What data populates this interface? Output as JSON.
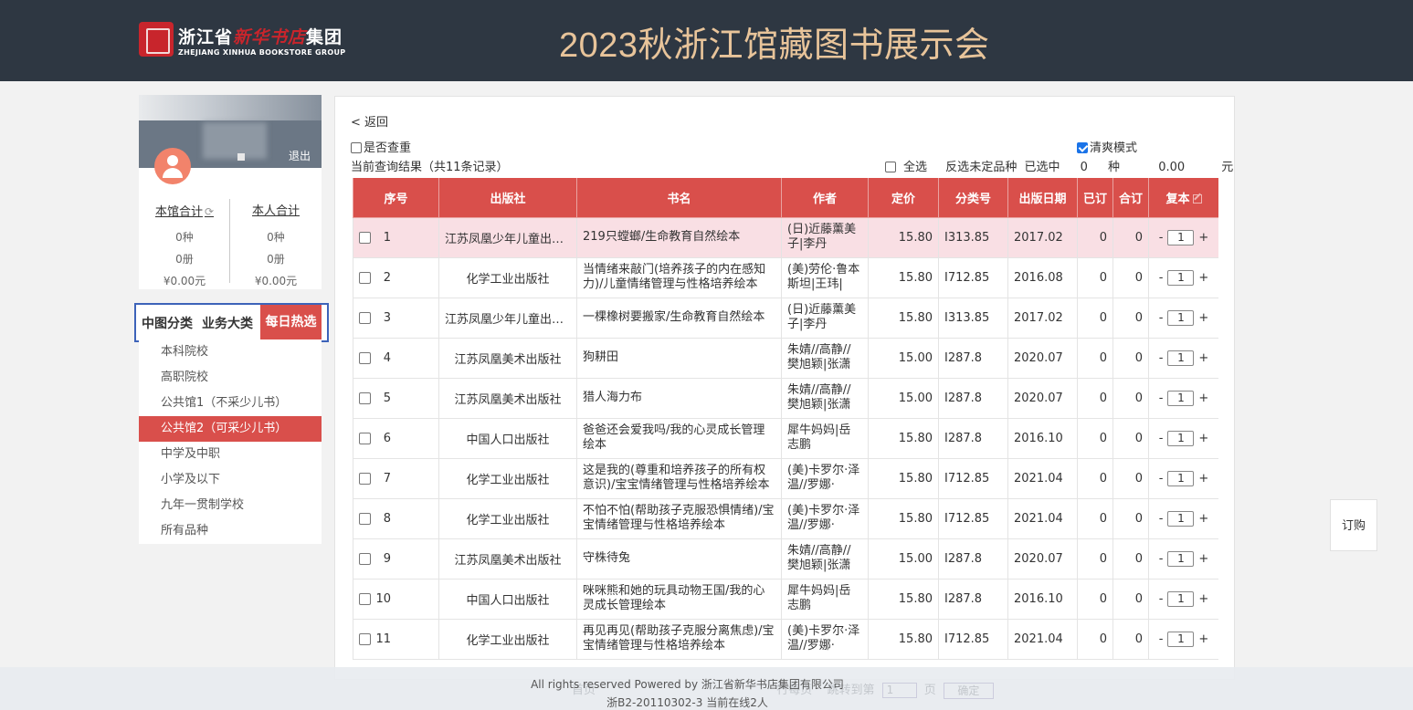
{
  "header": {
    "logo_cn_a": "浙江省",
    "logo_cn_calli": "新华书店",
    "logo_cn_b": "集团",
    "logo_en": "ZHEJIANG XINHUA BOOKSTORE GROUP",
    "title": "2023秋浙江馆藏图书展示会"
  },
  "user": {
    "logout": "退出",
    "stats": {
      "library_label": "本馆合计",
      "library_kinds": "0种",
      "library_volumes": "0册",
      "library_amount": "¥0.00元",
      "personal_label": "本人合计",
      "personal_kinds": "0种",
      "personal_volumes": "0册",
      "personal_amount": "¥0.00元"
    }
  },
  "category_tabs": [
    "中图分类",
    "业务大类",
    "每日热选"
  ],
  "category_list": [
    {
      "label": "本科院校",
      "active": false
    },
    {
      "label": "高职院校",
      "active": false
    },
    {
      "label": "公共馆1（不采少儿书）",
      "active": false
    },
    {
      "label": "公共馆2（可采少儿书）",
      "active": true
    },
    {
      "label": "中学及中职",
      "active": false
    },
    {
      "label": "小学及以下",
      "active": false
    },
    {
      "label": "九年一贯制学校",
      "active": false
    },
    {
      "label": "所有品种",
      "active": false
    }
  ],
  "main": {
    "back": "< 返回",
    "dedupe_label": "是否查重",
    "clean_mode_label": "清爽模式",
    "result_text": "当前查询结果（共11条记录）",
    "select_all": "全选",
    "invert": "反选",
    "undecided": "未定品种",
    "selected_label": "已选中",
    "selected_count": "0",
    "kind_unit": "种",
    "selected_amount": "0.00",
    "yuan_unit": "元"
  },
  "table": {
    "headers": [
      "序号",
      "出版社",
      "书名",
      "作者",
      "定价",
      "分类号",
      "出版日期",
      "已订",
      "合订",
      "复本"
    ],
    "rows": [
      {
        "no": "1",
        "publisher": "江苏凤凰少年儿童出版社",
        "title": "219只螳螂/生命教育自然绘本",
        "author": "(日)近藤薰美子|李丹",
        "price": "15.80",
        "class": "I313.85",
        "date": "2017.02",
        "ordered": "0",
        "combined": "0",
        "qty": "1"
      },
      {
        "no": "2",
        "publisher": "化学工业出版社",
        "title": "当情绪来敲门(培养孩子的内在感知力)/儿童情绪管理与性格培养绘本",
        "author": "(美)劳伦·鲁本斯坦|王玮|",
        "price": "15.80",
        "class": "I712.85",
        "date": "2016.08",
        "ordered": "0",
        "combined": "0",
        "qty": "1"
      },
      {
        "no": "3",
        "publisher": "江苏凤凰少年儿童出版社",
        "title": "一棵橡树要搬家/生命教育自然绘本",
        "author": "(日)近藤薰美子|李丹",
        "price": "15.80",
        "class": "I313.85",
        "date": "2017.02",
        "ordered": "0",
        "combined": "0",
        "qty": "1"
      },
      {
        "no": "4",
        "publisher": "江苏凤凰美术出版社",
        "title": "狗耕田",
        "author": "朱婧//高静//樊旭颖|张潇",
        "price": "15.00",
        "class": "I287.8",
        "date": "2020.07",
        "ordered": "0",
        "combined": "0",
        "qty": "1"
      },
      {
        "no": "5",
        "publisher": "江苏凤凰美术出版社",
        "title": "猎人海力布",
        "author": "朱婧//高静//樊旭颖|张潇",
        "price": "15.00",
        "class": "I287.8",
        "date": "2020.07",
        "ordered": "0",
        "combined": "0",
        "qty": "1"
      },
      {
        "no": "6",
        "publisher": "中国人口出版社",
        "title": "爸爸还会爱我吗/我的心灵成长管理绘本",
        "author": "犀牛妈妈|岳志鹏",
        "price": "15.80",
        "class": "I287.8",
        "date": "2016.10",
        "ordered": "0",
        "combined": "0",
        "qty": "1"
      },
      {
        "no": "7",
        "publisher": "化学工业出版社",
        "title": "这是我的(尊重和培养孩子的所有权意识)/宝宝情绪管理与性格培养绘本",
        "author": "(美)卡罗尔·泽温//罗娜·",
        "price": "15.80",
        "class": "I712.85",
        "date": "2021.04",
        "ordered": "0",
        "combined": "0",
        "qty": "1"
      },
      {
        "no": "8",
        "publisher": "化学工业出版社",
        "title": "不怕不怕(帮助孩子克服恐惧情绪)/宝宝情绪管理与性格培养绘本",
        "author": "(美)卡罗尔·泽温//罗娜·",
        "price": "15.80",
        "class": "I712.85",
        "date": "2021.04",
        "ordered": "0",
        "combined": "0",
        "qty": "1"
      },
      {
        "no": "9",
        "publisher": "江苏凤凰美术出版社",
        "title": "守株待兔",
        "author": "朱婧//高静//樊旭颖|张潇",
        "price": "15.00",
        "class": "I287.8",
        "date": "2020.07",
        "ordered": "0",
        "combined": "0",
        "qty": "1"
      },
      {
        "no": "10",
        "publisher": "中国人口出版社",
        "title": "咪咪熊和她的玩具动物王国/我的心灵成长管理绘本",
        "author": "犀牛妈妈|岳志鹏",
        "price": "15.80",
        "class": "I287.8",
        "date": "2016.10",
        "ordered": "0",
        "combined": "0",
        "qty": "1"
      },
      {
        "no": "11",
        "publisher": "化学工业出版社",
        "title": "再见再见(帮助孩子克服分离焦虑)/宝宝情绪管理与性格培养绘本",
        "author": "(美)卡罗尔·泽温//罗娜·",
        "price": "15.80",
        "class": "I712.85",
        "date": "2021.04",
        "ordered": "0",
        "combined": "0",
        "qty": "1"
      }
    ]
  },
  "order_button": "订购",
  "footer": {
    "pager_first": "首页",
    "pager_per_page": "行每页",
    "pager_goto": "跳转到第",
    "pager_page_value": "1",
    "pager_page_unit": "页",
    "pager_confirm": "确定",
    "copyright": "All rights reserved Powered by 浙江省新华书店集团有限公司",
    "icp": "浙B2-20110302-3   当前在线2人"
  },
  "colors": {
    "header_bg": "#2e3742",
    "title_color": "#e8c49a",
    "accent_red": "#d94f4b",
    "tab_border_blue": "#3d63b9",
    "highlight_row": "#f9dfe4"
  }
}
